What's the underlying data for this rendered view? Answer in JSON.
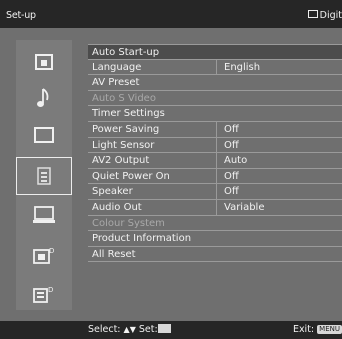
{
  "header": {
    "title": "Set-up",
    "source": "Digit"
  },
  "sidebar": {
    "items": [
      {
        "icon": "picture-icon"
      },
      {
        "icon": "music-note-icon"
      },
      {
        "icon": "screen-icon"
      },
      {
        "icon": "setup-icon",
        "active": true
      },
      {
        "icon": "monitor-icon"
      },
      {
        "icon": "digital-picture-icon"
      },
      {
        "icon": "digital-setup-icon"
      }
    ]
  },
  "menu": {
    "rows": [
      {
        "label": "Auto Start-up",
        "value": ""
      },
      {
        "label": "Language",
        "value": "English"
      },
      {
        "label": "AV Preset",
        "value": ""
      },
      {
        "label": "Auto S Video",
        "value": "",
        "disabled": true
      },
      {
        "label": "Timer Settings",
        "value": ""
      },
      {
        "label": "Power Saving",
        "value": "Off"
      },
      {
        "label": "Light Sensor",
        "value": "Off"
      },
      {
        "label": "AV2 Output",
        "value": "Auto"
      },
      {
        "label": "Quiet Power On",
        "value": "Off"
      },
      {
        "label": "Speaker",
        "value": "Off"
      },
      {
        "label": "Audio Out",
        "value": "Variable"
      },
      {
        "label": "Colour System",
        "value": "",
        "disabled": true
      },
      {
        "label": "Product Information",
        "value": ""
      },
      {
        "label": "All Reset",
        "value": ""
      }
    ]
  },
  "footer": {
    "select_label": "Select:",
    "set_label": "Set:",
    "exit_label": "Exit:",
    "exit_key": "MENU"
  },
  "colors": {
    "background": "#6f6f6f",
    "bar": "#262626",
    "highlight": "#4c4c4c"
  }
}
